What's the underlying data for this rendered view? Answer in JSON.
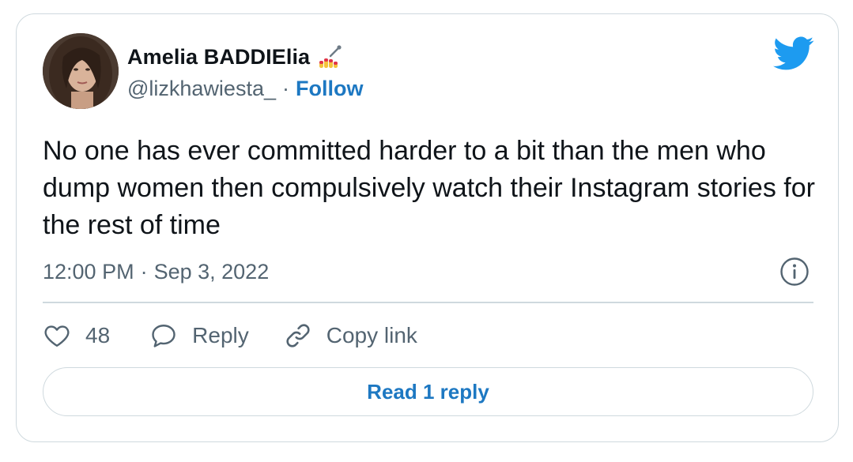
{
  "author": {
    "display_name": "Amelia BADDIElia",
    "handle": "@lizkhawiesta_",
    "separator": "·",
    "follow_label": "Follow",
    "avatar_icon": "profile-photo",
    "name_emoji_icon": "nail-polish-icon"
  },
  "brand": {
    "icon": "twitter-bird-icon",
    "color": "#1d9bf0"
  },
  "tweet": {
    "text": "No one has ever committed harder to a bit than the men who dump women then compulsively watch their Instagram stories for the rest of time",
    "time": "12:00 PM",
    "separator": "·",
    "date": "Sep 3, 2022"
  },
  "actions": {
    "like_count": "48",
    "reply_label": "Reply",
    "copy_link_label": "Copy link"
  },
  "read_replies_label": "Read 1 reply",
  "colors": {
    "link_blue": "#1d78c2",
    "text_primary": "#0f1419",
    "text_secondary": "#536471",
    "border": "#cfd9de"
  }
}
